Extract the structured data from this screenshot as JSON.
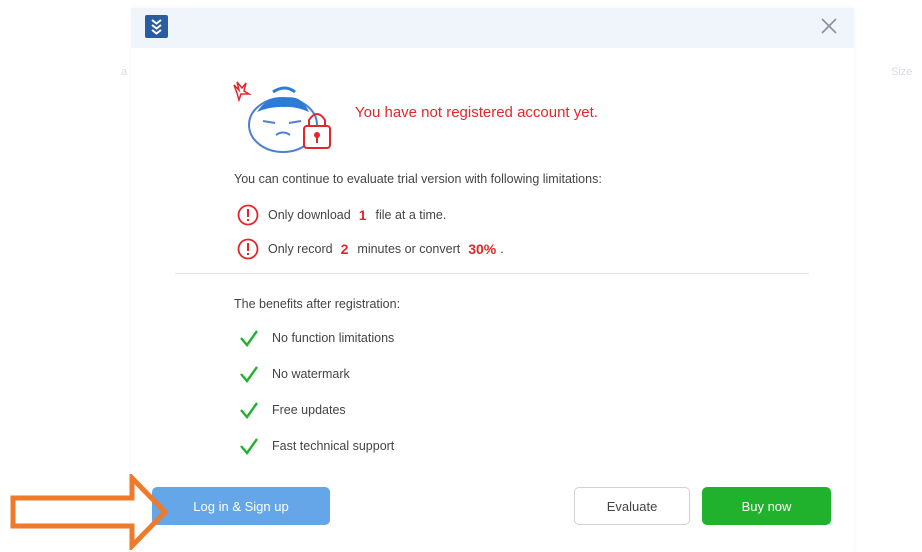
{
  "background": {
    "left_column": "a",
    "right_column": "Size"
  },
  "dialog": {
    "app_icon": "downloader-app-icon",
    "close_icon": "close-icon",
    "headline": "You have not registered account yet.",
    "intro": "You can continue to evaluate trial version with following limitations:",
    "limitations": [
      {
        "prefix": "Only download",
        "value": "1",
        "suffix": "file at a time."
      },
      {
        "prefix": "Only record",
        "value": "2",
        "middle": "minutes or convert",
        "value2": "30%",
        "suffix": "."
      }
    ],
    "benefits_title": "The benefits after registration:",
    "benefits": [
      "No function limitations",
      "No watermark",
      "Free updates",
      "Fast technical support"
    ],
    "buttons": {
      "login": "Log in & Sign up",
      "evaluate": "Evaluate",
      "buy": "Buy now"
    }
  },
  "colors": {
    "accent_red": "#e3262b",
    "check_green": "#21b22d",
    "login_blue": "#64a6e8",
    "arrow_orange": "#ef7a2a"
  }
}
